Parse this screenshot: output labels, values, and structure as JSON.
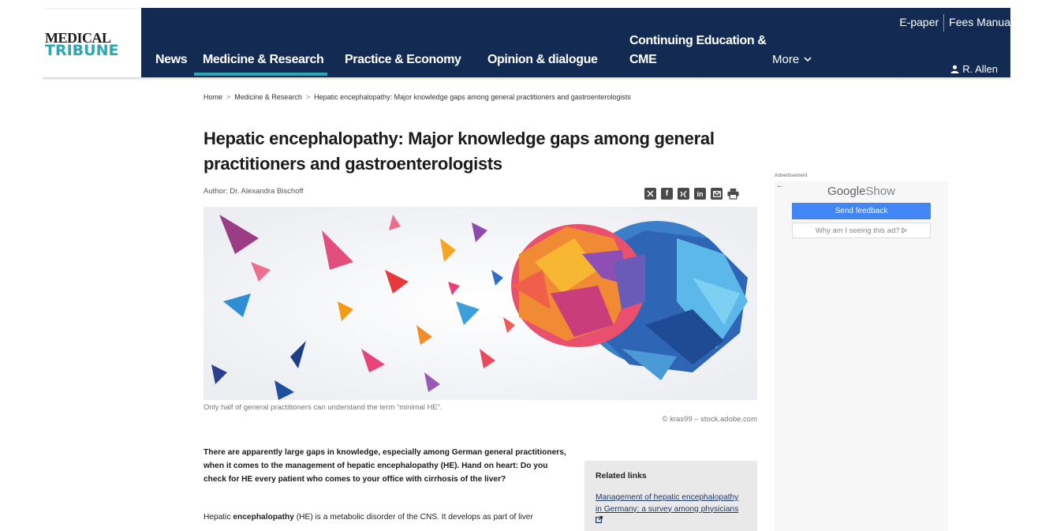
{
  "logo": {
    "line1": "MEDICAL",
    "line2": "TRIBUNE"
  },
  "nav": {
    "items": [
      {
        "label": "News"
      },
      {
        "label": "Medicine & Research"
      },
      {
        "label": "Practice & Economy"
      },
      {
        "label": "Opinion & dialogue"
      },
      {
        "label": "Continuing Education &"
      },
      {
        "label": "CME"
      }
    ],
    "more": "More",
    "top_links": [
      "E-paper",
      "Fees Manua"
    ],
    "user": "R. Allen",
    "active_color": "#2aa7b3",
    "bar_color": "#132b52"
  },
  "breadcrumb": {
    "home": "Home",
    "section": "Medicine & Research",
    "current": "Hepatic encephalopathy: Major knowledge gaps among general practitioners and gastroenterologists"
  },
  "article": {
    "title": "Hepatic encephalopathy: Major knowledge gaps among general practitioners and gastroenterologists",
    "author": "Author: Dr. Alexandra Bischoff",
    "share_icons": [
      "x-icon",
      "facebook-icon",
      "xing-icon",
      "linkedin-icon",
      "mail-icon",
      "print-icon"
    ],
    "caption": "Only half of general practitioners can understand the term “minimal HE”.",
    "credit": "© kras99 – stock.adobe.com",
    "lead": "There are apparently large gaps in knowledge, especially among German general practitioners, when it comes to the management of hepatic encephalopathy (HE). Hand on heart: Do you check for HE every patient who comes to your office with cirrhosis of the liver?",
    "para_pre": "Hepatic ",
    "para_bold": "encephalopathy",
    "para_post": " (HE) is a metabolic disorder of the CNS. It develops as part of liver"
  },
  "related": {
    "heading": "Related links",
    "link1": "Management of hepatic encephalopathy in Germany: a survey among physicians"
  },
  "ad": {
    "label": "Advertisement",
    "google": "Google",
    "show": "Show",
    "send_feedback": "Send feedback",
    "why": "Why am I seeing this ad?"
  }
}
